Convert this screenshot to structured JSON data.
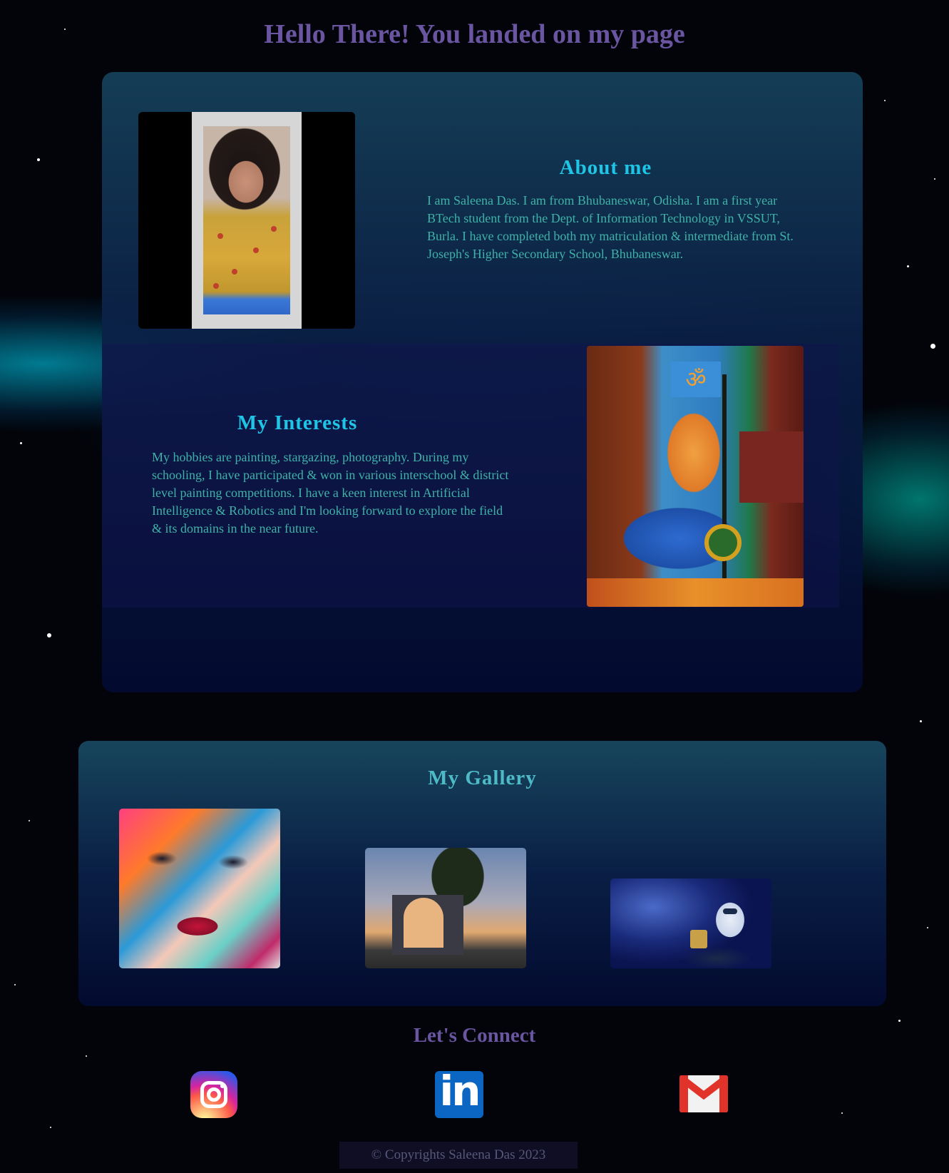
{
  "header": {
    "title": "Hello There! You landed on my page"
  },
  "about": {
    "heading": "About me",
    "text": "I am Saleena Das. I am from Bhubaneswar, Odisha. I am a first year BTech student from the Dept. of Information Technology in VSSUT, Burla. I have completed both my matriculation & intermediate from St. Joseph's Higher Secondary School, Bhubaneswar."
  },
  "interests": {
    "heading": "My Interests",
    "text": "My hobbies are painting, stargazing, photography. During my schooling, I have participated & won in various interschool & district level painting competitions. I have a keen interest in Artificial Intelligence & Robotics and I'm looking forward to explore the field & its domains in the near future."
  },
  "gallery": {
    "heading": "My Gallery",
    "images": [
      "abstract-face-painting",
      "gateway-arch-photo",
      "wall-e-robot-image"
    ]
  },
  "connect": {
    "heading": "Let's Connect",
    "links": [
      "instagram-icon",
      "linkedin-icon",
      "gmail-icon"
    ]
  },
  "footer": {
    "copyright": "© Copyrights Saleena Das 2023"
  },
  "colors": {
    "title": "#6a55a0",
    "heading": "#1fc5e6",
    "body_text": "#3fb2a8",
    "gallery_heading": "#4dbac6",
    "footer_text": "#57587a"
  }
}
